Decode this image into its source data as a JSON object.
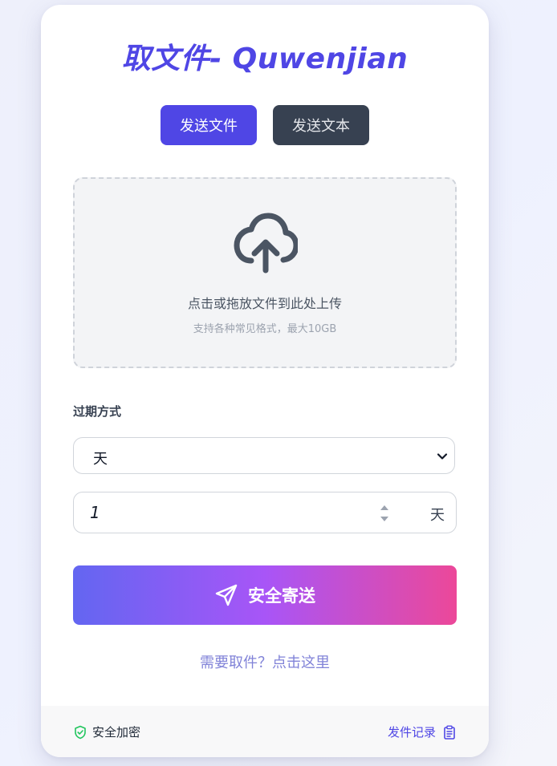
{
  "title": "取文件- Quwenjian",
  "tabs": [
    {
      "label": "发送文件",
      "active": true
    },
    {
      "label": "发送文本",
      "active": false
    }
  ],
  "upload": {
    "title": "点击或拖放文件到此处上传",
    "subtitle": "支持各种常见格式，最大10GB",
    "icon": "cloud-upload-icon"
  },
  "expiry": {
    "label": "过期方式",
    "selected": "天",
    "amount": "1",
    "unit": "天"
  },
  "send_button": {
    "label": "安全寄送",
    "icon": "paper-plane-icon"
  },
  "retrieve_link": "需要取件？点击这里",
  "footer": {
    "secure_label": "安全加密",
    "records_label": "发件记录"
  },
  "colors": {
    "accent": "#4f46e5",
    "dark_tab": "#374151",
    "gradient_start": "#6366f1",
    "gradient_mid": "#a855f7",
    "gradient_end": "#ec4899",
    "secure_green": "#22c55e"
  }
}
